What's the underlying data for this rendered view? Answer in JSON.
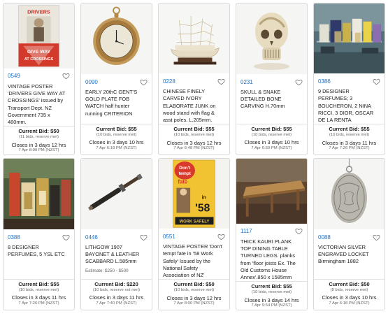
{
  "lots": [
    {
      "lot": "0549",
      "title": "VINTAGE POSTER 'DRIVERS GIVE WAY AT CROSSINGS' issued by Transport Dept. NZ Government 735 x 480mm.",
      "estimate": "",
      "current_bid": "Current Bid: $50",
      "bid_meta": "(11 bids, reserve met)",
      "closes": "Closes in 3 days 12 hrs",
      "close_date": "7 Apr 8:00 PM (NZST)",
      "image": "drivers-give-way-poster",
      "poster_text": [
        "DRIVERS",
        "GIVE WAY",
        "AT CROSSINGS"
      ]
    },
    {
      "lot": "0090",
      "title": "EARLY 20thC GENT'S GOLD PLATE FOB WATCH half hunter running CRITERION",
      "estimate": "",
      "current_bid": "Current Bid: $55",
      "bid_meta": "(10 bids, reserve met)",
      "closes": "Closes in 3 days 10 hrs",
      "close_date": "7 Apr 6:18 PM (NZST)",
      "image": "gold-fob-watch"
    },
    {
      "lot": "0228",
      "title": "CHINESE FINELY CARVED IVORY ELABORATE JUNK on wood stand with flag & asst poles. L.205mm.",
      "estimate": "",
      "current_bid": "Current Bid: $55",
      "bid_meta": "(10 bids, reserve met)",
      "closes": "Closes in 3 days 12 hrs",
      "close_date": "7 Apr 6:48 PM (NZST)",
      "image": "ivory-junk-carving"
    },
    {
      "lot": "0231",
      "title": "SKULL & SNAKE DETAILED BONE CARVING H.70mm",
      "estimate": "",
      "current_bid": "Current Bid: $55",
      "bid_meta": "(10 bids, reserve met)",
      "closes": "Closes in 3 days 10 hrs",
      "close_date": "7 Apr 6:50 PM (NZST)",
      "image": "skull-bone-carving"
    },
    {
      "lot": "0386",
      "title": "9 DESIGNER PERFUMES; 3 BOUCHERON, 2 NINA RICCI, 3 DIOR, OSCAR DE LA RENTA",
      "estimate": "",
      "current_bid": "Current Bid: $55",
      "bid_meta": "(10 bids, reserve met)",
      "closes": "Closes in 3 days 11 hrs",
      "close_date": "7 Apr 7:26 PM (NZST)",
      "image": "perfume-boxes"
    },
    {
      "lot": "0388",
      "title": "8 DESIGNER PERFUMES, 5 YSL ETC",
      "estimate": "",
      "current_bid": "Current Bid: $55",
      "bid_meta": "(10 bids, reserve met)",
      "closes": "Closes in 3 days 11 hrs",
      "close_date": "7 Apr 7:26 PM (NZST)",
      "image": "perfume-display"
    },
    {
      "lot": "0446",
      "title": "LITHGOW 1907 BAYONET & LEATHER SCABBARD L.585mm",
      "estimate": "Estimate: $250 - $500",
      "current_bid": "Current Bid: $220",
      "bid_meta": "(10 bids, reserve not met)",
      "closes": "Closes in 3 days 11 hrs",
      "close_date": "7 Apr 7:40 PM (NZST)",
      "image": "bayonet-scabbard"
    },
    {
      "lot": "0551",
      "title": "VINTAGE POSTER 'Don't tempt fate in '58 Work Safely' Issued by the National Safety Association of NZ'",
      "estimate": "",
      "current_bid": "Current Bid: $50",
      "bid_meta": "(10 bids, reserve met)",
      "closes": "Closes in 3 days 12 hrs",
      "close_date": "7 Apr 8:00 PM (NZST)",
      "image": "dont-tempt-fate-poster",
      "poster_text": [
        "Don't",
        "tempt",
        "fate",
        "in",
        "'58",
        "WORK SAFELY"
      ]
    },
    {
      "lot": "1117",
      "title": "THICK KAURI PLANK TOP DINING TABLE TURNED LEGS. planks from 'floor joists Ex. The Old Customs House Annex'.850 x 1585mm",
      "estimate": "",
      "current_bid": "Current Bid: $55",
      "bid_meta": "(10 bids, reserve met)",
      "closes": "Closes in 3 days 14 hrs",
      "close_date": "7 Apr 9:54 PM (NZST)",
      "image": "kauri-dining-table"
    },
    {
      "lot": "0088",
      "title": "VICTORIAN SILVER ENGRAVED LOCKET Birmingham 1882",
      "estimate": "",
      "current_bid": "Current Bid: $50",
      "bid_meta": "(8 bids, reserve met)",
      "closes": "Closes in 3 days 10 hrs",
      "close_date": "7 Apr 6:18 PM (NZST)",
      "image": "silver-locket"
    }
  ],
  "colors": {
    "lot_link": "#1a6fc9",
    "border": "#d9d9d9",
    "muted_text": "#666666",
    "poster_red": "#c8322a",
    "poster_yellow": "#f1c232"
  }
}
